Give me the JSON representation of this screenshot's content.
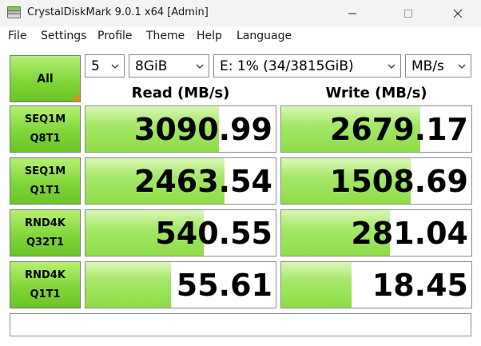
{
  "window": {
    "title": "CrystalDiskMark 9.0.1 x64 [Admin]"
  },
  "menu": [
    "File",
    "Settings",
    "Profile",
    "Theme",
    "Help",
    "Language"
  ],
  "controls": {
    "all_label": "All",
    "count": "5",
    "size": "8GiB",
    "drive": "E: 1% (34/3815GiB)",
    "unit": "MB/s"
  },
  "headers": {
    "read": "Read (MB/s)",
    "write": "Write (MB/s)"
  },
  "tests": [
    {
      "line1": "SEQ1M",
      "line2": "Q8T1",
      "read": "3090.99",
      "write": "2679.17",
      "read_fill": 0.7,
      "write_fill": 0.73
    },
    {
      "line1": "SEQ1M",
      "line2": "Q1T1",
      "read": "2463.54",
      "write": "1508.69",
      "read_fill": 0.73,
      "write_fill": 0.68
    },
    {
      "line1": "RND4K",
      "line2": "Q32T1",
      "read": "540.55",
      "write": "281.04",
      "read_fill": 0.62,
      "write_fill": 0.57
    },
    {
      "line1": "RND4K",
      "line2": "Q1T1",
      "read": "55.61",
      "write": "18.45",
      "read_fill": 0.45,
      "write_fill": 0.37
    }
  ],
  "status_text": "",
  "colors": {
    "button_green": "#82d63a",
    "bar_green": "#a6e86a",
    "corner_orange": "#e88a1a"
  }
}
